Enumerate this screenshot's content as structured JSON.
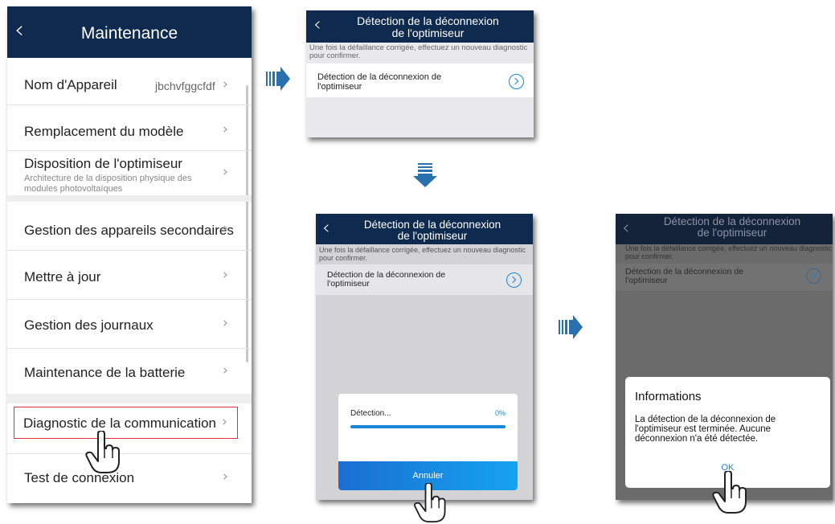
{
  "maintenance_screen": {
    "title": "Maintenance",
    "items": [
      {
        "label": "Nom d'Appareil",
        "value": "jbchvfggcfdf"
      },
      {
        "label": "Remplacement du modèle"
      },
      {
        "label": "Disposition de l'optimiseur",
        "sublabel": "Architecture de la disposition physique des modules photovoltaïques"
      },
      {
        "label": "Gestion des appareils secondaires"
      },
      {
        "label": "Mettre à jour"
      },
      {
        "label": "Gestion des journaux"
      },
      {
        "label": "Maintenance de la batterie"
      },
      {
        "label": "Diagnostic de la communication"
      },
      {
        "label": "Test de connexion"
      }
    ]
  },
  "detection_screen": {
    "title_line1": "Détection de la déconnexion",
    "title_line2": "de l'optimiseur",
    "hint": "Une fois la défaillance corrigée, effectuez un nouveau diagnostic pour confirmer.",
    "item_line1": "Détection de la déconnexion de",
    "item_line2": "l'optimiseur"
  },
  "progress_dialog": {
    "label": "Détection...",
    "percent_text": "0%",
    "progress": 0,
    "cancel_label": "Annuler"
  },
  "result_dialog": {
    "title": "Informations",
    "message": "La détection de la déconnexion de l'optimiseur est terminée. Aucune déconnexion n'a été détectée.",
    "ok_label": "OK"
  },
  "colors": {
    "header": "#0f2a4f",
    "accent": "#1a86d6",
    "highlight": "#e0303a",
    "arrow": "#2a6fae"
  }
}
